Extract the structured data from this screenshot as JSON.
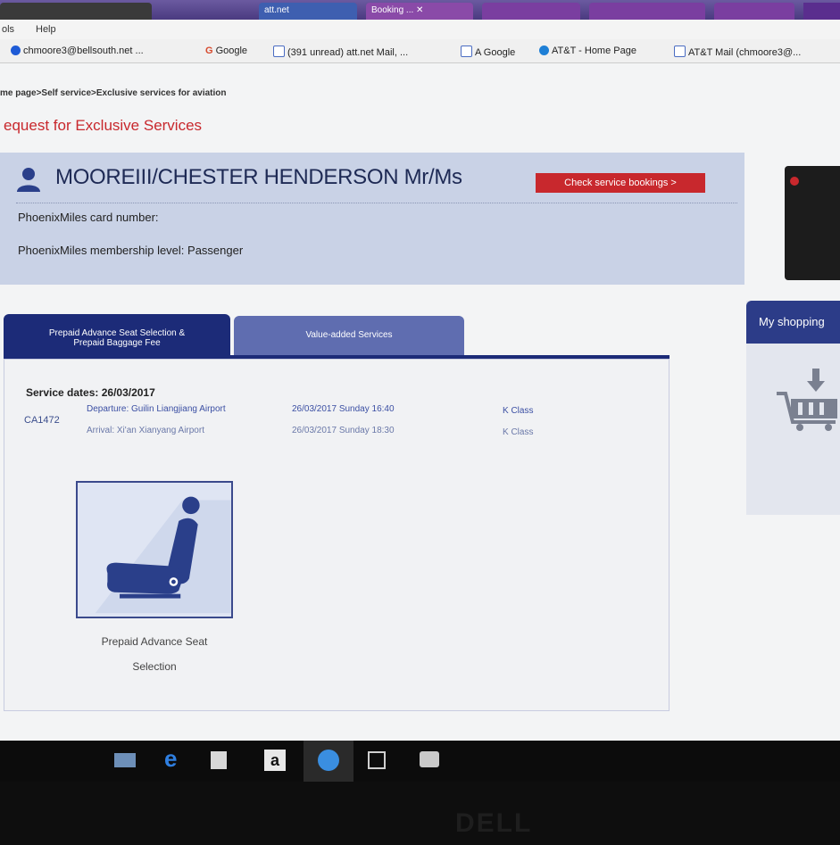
{
  "browser": {
    "tabs": [
      "att.net",
      "Booking ... ✕",
      "",
      "",
      ""
    ],
    "menu": [
      "ols",
      "Help"
    ],
    "bookmarks": [
      {
        "label": "chmoore3@bellsouth.net ...",
        "icon": "globe-icon",
        "color": "#1e5bd6"
      },
      {
        "label": "Google",
        "icon": "google-icon",
        "color": "#d64a2e"
      },
      {
        "label": "(391 unread) att.net Mail, ...",
        "icon": "page-icon",
        "color": "#4a6cc2"
      },
      {
        "label": "A Google",
        "icon": "page-icon",
        "color": "#4a6cc2"
      },
      {
        "label": "AT&T - Home Page",
        "icon": "att-icon",
        "color": "#1e7fd6"
      },
      {
        "label": "AT&T Mail (chmoore3@...",
        "icon": "page-icon",
        "color": "#4a6cc2"
      }
    ]
  },
  "page": {
    "breadcrumb": "me page>Self service>Exclusive services for aviation",
    "title": "equest for Exclusive Services"
  },
  "passenger": {
    "name": "MOOREIII/CHESTER HENDERSON  Mr/Ms",
    "check_button": "Check service bookings >",
    "card_number_label": "PhoenixMiles card number:",
    "membership_label": "PhoenixMiles membership level: Passenger"
  },
  "service_tabs": {
    "active_line1": "Prepaid Advance Seat Selection &",
    "active_line2": "Prepaid Baggage Fee",
    "inactive": "Value-added Services"
  },
  "service": {
    "dates_label": "Service dates: 26/03/2017",
    "flight_no": "CA1472",
    "departure": "Departure: Guilin Liangjiang Airport",
    "departure_time": "26/03/2017 Sunday 16:40",
    "departure_class": "K Class",
    "arrival": "Arrival: Xi'an Xianyang Airport",
    "arrival_time": "26/03/2017 Sunday 18:30",
    "arrival_class": "K Class",
    "seat_option_line1": "Prepaid Advance Seat",
    "seat_option_line2": "Selection"
  },
  "shopping": {
    "title": "My shopping"
  },
  "taskbar": {
    "icons": [
      "file-explorer-icon",
      "edge-icon",
      "store-icon",
      "amazon-icon",
      "ie-icon",
      "calculator-icon",
      "photos-icon"
    ],
    "amazon_letter": "a",
    "edge_letter": "e"
  },
  "bezel": {
    "brand": "DELL"
  },
  "colors": {
    "accent_red": "#c8282d",
    "navy": "#1c2b78",
    "panel": "#c9d2e6"
  }
}
